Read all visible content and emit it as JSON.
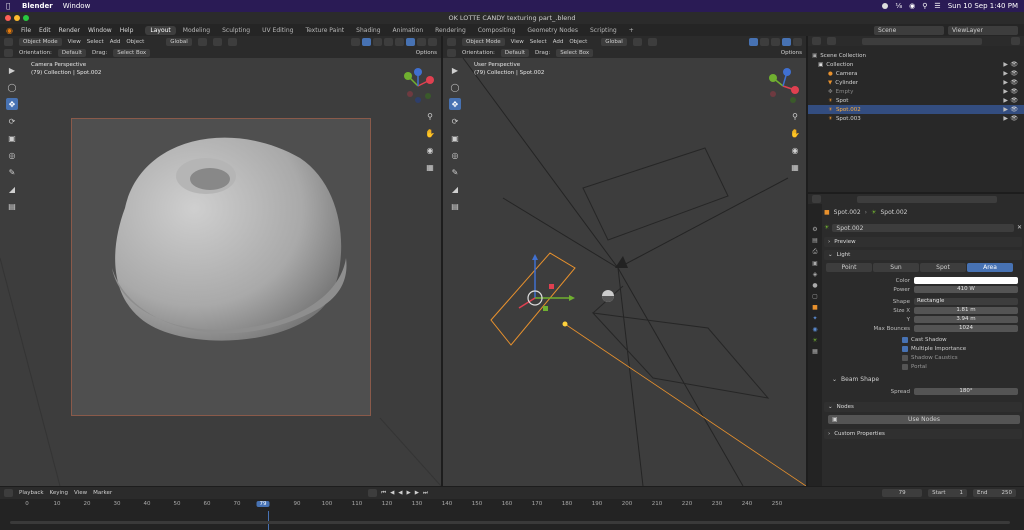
{
  "macos": {
    "app_name": "Blender",
    "menus": [
      "Window"
    ],
    "datetime": "Sun 10 Sep  1:40 PM"
  },
  "window_title": "OK LOTTE CANDY texturing part_.blend",
  "topbar": {
    "menus": [
      "File",
      "Edit",
      "Render",
      "Window",
      "Help"
    ],
    "workspaces": [
      "Layout",
      "Modeling",
      "Sculpting",
      "UV Editing",
      "Texture Paint",
      "Shading",
      "Animation",
      "Rendering",
      "Compositing",
      "Geometry Nodes",
      "Scripting"
    ],
    "active_workspace": "Layout",
    "scene": "Scene",
    "view_layer": "ViewLayer"
  },
  "viewport_left": {
    "mode": "Object Mode",
    "menus": [
      "View",
      "Select",
      "Add",
      "Object"
    ],
    "transform": "Global",
    "orientation_label": "Orientation:",
    "orientation_value": "Default",
    "drag_label": "Drag:",
    "drag_value": "Select Box",
    "options": "Options",
    "info_line1": "Camera Perspective",
    "info_line2": "(79) Collection | Spot.002"
  },
  "viewport_right": {
    "mode": "Object Mode",
    "menus": [
      "View",
      "Select",
      "Add",
      "Object"
    ],
    "transform": "Global",
    "orientation_label": "Orientation:",
    "orientation_value": "Default",
    "drag_label": "Drag:",
    "drag_value": "Select Box",
    "options": "Options",
    "info_line1": "User Perspective",
    "info_line2": "(79) Collection | Spot.002"
  },
  "outliner": {
    "root": "Scene Collection",
    "collection": "Collection",
    "items": [
      {
        "name": "Camera",
        "selected": false
      },
      {
        "name": "Cylinder",
        "selected": false
      },
      {
        "name": "Empty",
        "selected": false
      },
      {
        "name": "Spot",
        "selected": false
      },
      {
        "name": "Spot.002",
        "selected": true
      },
      {
        "name": "Spot.003",
        "selected": false
      }
    ]
  },
  "properties": {
    "breadcrumb_obj": "Spot.002",
    "breadcrumb_data": "Spot.002",
    "datablock": "Spot.002",
    "preview": "Preview",
    "light": "Light",
    "light_types": [
      "Point",
      "Sun",
      "Spot",
      "Area"
    ],
    "active_type": "Area",
    "color_label": "Color",
    "power_label": "Power",
    "power_value": "410 W",
    "shape_label": "Shape",
    "shape_value": "Rectangle",
    "size_x_label": "Size X",
    "size_x_value": "1.81 m",
    "y_label": "Y",
    "y_value": "3.94 m",
    "bounces_label": "Max Bounces",
    "bounces_value": "1024",
    "cast_shadow": "Cast Shadow",
    "multiple_importance": "Multiple Importance",
    "shadow_caustics": "Shadow Caustics",
    "portal": "Portal",
    "beam_shape": "Beam Shape",
    "spread_label": "Spread",
    "spread_value": "180°",
    "nodes": "Nodes",
    "use_nodes": "Use Nodes",
    "custom_properties": "Custom Properties"
  },
  "timeline": {
    "menus": [
      "Playback",
      "Keying",
      "View",
      "Marker"
    ],
    "current_frame": "79",
    "start_label": "Start",
    "start_value": "1",
    "end_label": "End",
    "end_value": "250",
    "ticks": [
      "0",
      "10",
      "20",
      "30",
      "40",
      "50",
      "60",
      "70",
      "79",
      "90",
      "100",
      "110",
      "120",
      "130",
      "140",
      "150",
      "160",
      "170",
      "180",
      "190",
      "200",
      "210",
      "220",
      "230",
      "240",
      "250"
    ]
  },
  "colors": {
    "accent_blue": "#4772b3",
    "selection_orange": "#e8912d",
    "mac_menubar": "#2a1b55"
  }
}
